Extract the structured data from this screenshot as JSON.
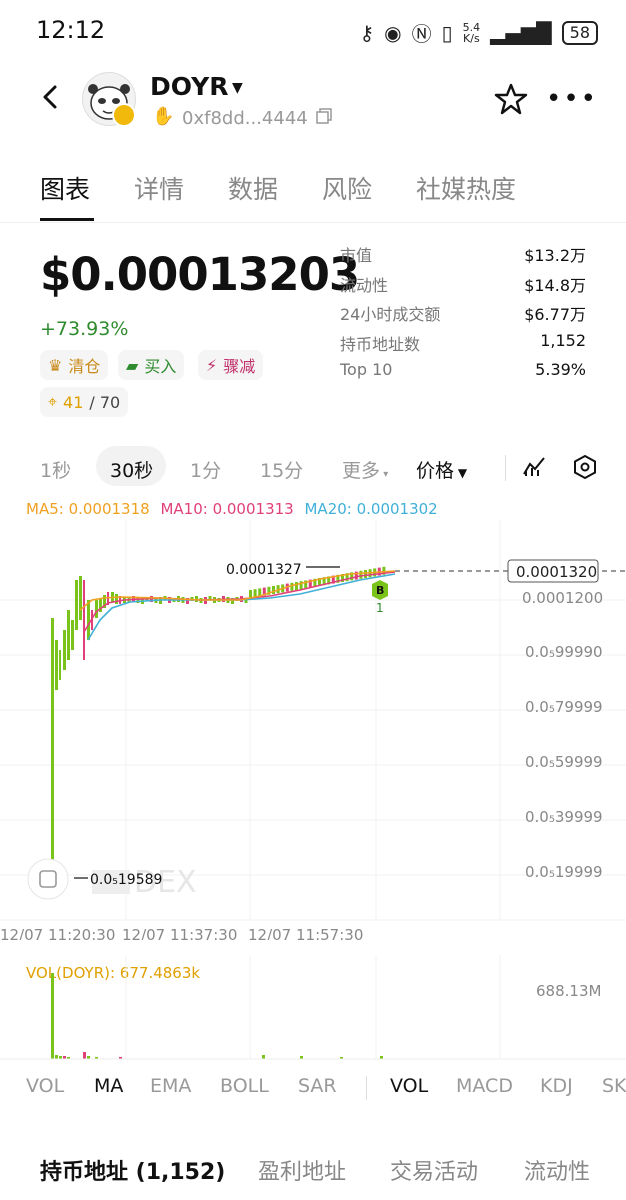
{
  "status_bar": {
    "time": "12:12",
    "net_speed_top": "5.4",
    "net_speed_bottom": "K/s",
    "battery": "58"
  },
  "header": {
    "token_name": "DOYR",
    "address": "0xf8dd...4444"
  },
  "tabs": [
    {
      "label": "图表"
    },
    {
      "label": "详情"
    },
    {
      "label": "数据"
    },
    {
      "label": "风险"
    },
    {
      "label": "社媒热度"
    }
  ],
  "price": {
    "value": "$0.00013203",
    "change": "+73.93%"
  },
  "chips": {
    "clear": "清仓",
    "buy": "买入",
    "drop": "骤减",
    "score": "41",
    "score_total": "/ 70"
  },
  "stats": [
    {
      "label": "市值",
      "value": "$13.2万"
    },
    {
      "label": "流动性",
      "value": "$14.8万"
    },
    {
      "label": "24小时成交额",
      "value": "$6.77万"
    },
    {
      "label": "持币地址数",
      "value": "1,152"
    },
    {
      "label": "Top 10",
      "value": "5.39%"
    }
  ],
  "timeframes": {
    "s1": "1秒",
    "s30": "30秒",
    "m1": "1分",
    "m15": "15分",
    "more": "更多",
    "price": "价格"
  },
  "ma_legend": {
    "ma5": "MA5: 0.0001318",
    "ma10": "MA10: 0.0001313",
    "ma20": "MA20: 0.0001302"
  },
  "colors": {
    "ma5": "#f0a020",
    "ma10": "#e0407a",
    "ma20": "#40b0d8",
    "candle_up": "#7ac31a",
    "candle_down": "#e0407a"
  },
  "chart_data": {
    "type": "line",
    "y_tick_labels": [
      "0.0001200",
      "0.0₅99990",
      "0.0₅79999",
      "0.0₅59999",
      "0.0₅39999",
      "0.0₅19999"
    ],
    "x_tick_labels": [
      "12/07 11:20:30",
      "12/07 11:37:30",
      "12/07 11:57:30"
    ],
    "current_price_label": "0.0001320",
    "high_label": "0.0001327",
    "low_label": "0.0₅19589",
    "trade_marker": "B",
    "trade_marker_count": "1",
    "watermark": "DEX"
  },
  "volume": {
    "label": "VOL(DOYR): 677.4863k",
    "max": "688.13M"
  },
  "indicators_left": [
    "VOL",
    "MA",
    "EMA",
    "BOLL",
    "SAR"
  ],
  "indicators_right": [
    "VOL",
    "MACD",
    "KDJ",
    "SK"
  ],
  "bottom_tabs": [
    "持币地址 (1,152)",
    "盈利地址",
    "交易活动",
    "流动性"
  ]
}
